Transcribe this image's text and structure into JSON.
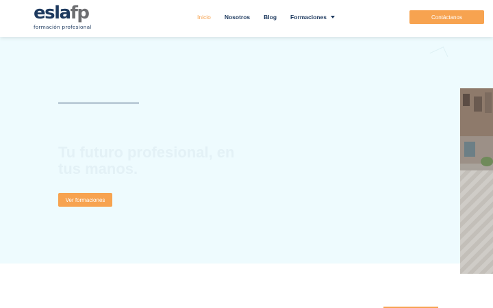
{
  "brand": {
    "logo_part1": "esla",
    "logo_part2": "fp",
    "tagline": "formación profesional",
    "primary_color": "#1e3a5f",
    "accent_color": "#f7a350"
  },
  "nav": {
    "items": [
      {
        "label": "Inicio",
        "active": true
      },
      {
        "label": "Nosotros",
        "active": false
      },
      {
        "label": "Blog",
        "active": false
      },
      {
        "label": "Formaciones",
        "active": false,
        "has_dropdown": true
      }
    ]
  },
  "header": {
    "cta_label": "Contáctanos"
  },
  "hero": {
    "title": "Tu futuro profesional, en tus manos.",
    "button_label": "Ver formaciones",
    "background_color": "#eefbfe"
  },
  "icons": {
    "dropdown": "chevron-down-icon"
  }
}
